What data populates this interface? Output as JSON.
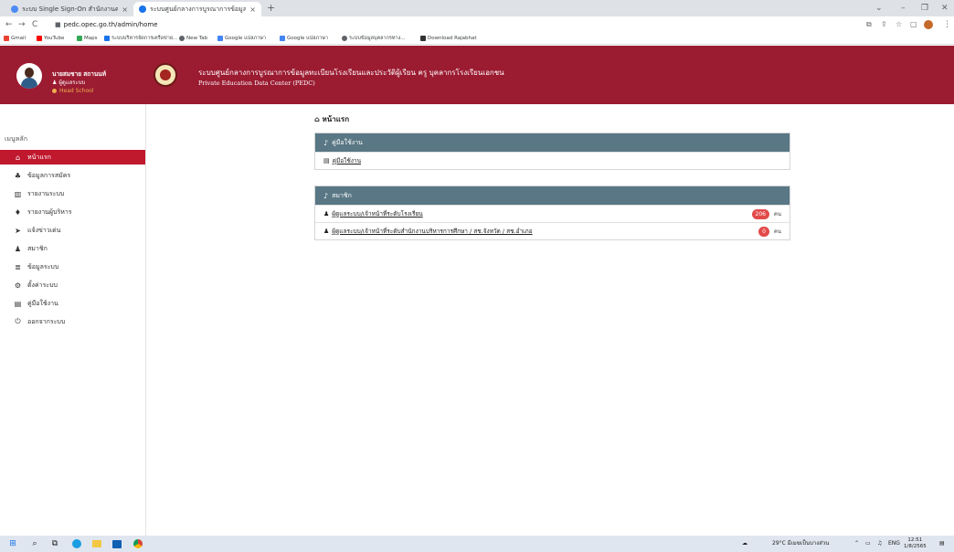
{
  "browser": {
    "tabs": [
      {
        "label": "ระบบ Single Sign-On สำนักงานคณะ...",
        "close": "×",
        "color": "#4c8bf5"
      },
      {
        "label": "ระบบศูนย์กลางการบูรณาการข้อมูล...",
        "close": "×",
        "color": "#1a73e8"
      }
    ],
    "new_tab": "+",
    "window_controls": {
      "chevron": "⌄",
      "minimize": "–",
      "maximize": "❐",
      "close": "✕"
    },
    "nav": {
      "back": "←",
      "forward": "→",
      "reload": "C"
    },
    "url": "pedc.opec.go.th/admin/home",
    "right_icons": {
      "translate": "⧉",
      "share": "⇪",
      "star": "☆",
      "sidepanel": "▢",
      "menu": "⋮"
    },
    "bookmarks": [
      {
        "label": "Gmail",
        "color": "#ea4335"
      },
      {
        "label": "YouTube",
        "color": "#ff0000"
      },
      {
        "label": "Maps",
        "color": "#34a853"
      },
      {
        "label": "ระบบบริหารจัดการเครือข่าย...",
        "color": "#1a73e8"
      },
      {
        "label": "New Tab",
        "color": "#5f6368"
      },
      {
        "label": "Google แปลภาษา",
        "color": "#4285f4"
      },
      {
        "label": "Google แปลภาษา",
        "color": "#4285f4"
      },
      {
        "label": "ระบบข้อมูลบุคลากรทาง...",
        "color": "#5f6368"
      },
      {
        "label": "Download Rajabhat",
        "color": "#333333"
      }
    ]
  },
  "sidebar": {
    "profile": {
      "name": "นายสมชาย สถานนท์",
      "role": "ผู้ดูแลระบบ",
      "status": "Head School"
    },
    "menu_title": "เมนูหลัก",
    "items": [
      {
        "label": "หน้าแรก",
        "icon": "home-icon",
        "glyph": "⌂",
        "active": true
      },
      {
        "label": "ข้อมูลการสมัคร",
        "icon": "users-icon",
        "glyph": "♣",
        "active": false
      },
      {
        "label": "รายงานระบบ",
        "icon": "chart-icon",
        "glyph": "▥",
        "active": false
      },
      {
        "label": "รายงานผู้บริหาร",
        "icon": "manager-icon",
        "glyph": "♦",
        "active": false
      },
      {
        "label": "แจ้งข่าวเด่น",
        "icon": "send-icon",
        "glyph": "➤",
        "active": false
      },
      {
        "label": "สมาชิก",
        "icon": "member-icon",
        "glyph": "♟",
        "active": false
      },
      {
        "label": "ข้อมูลระบบ",
        "icon": "database-icon",
        "glyph": "≣",
        "active": false
      },
      {
        "label": "ตั้งค่าระบบ",
        "icon": "settings-icon",
        "glyph": "⚙",
        "active": false
      },
      {
        "label": "คู่มือใช้งาน",
        "icon": "book-icon",
        "glyph": "▤",
        "active": false
      },
      {
        "label": "ออกจากระบบ",
        "icon": "power-icon",
        "glyph": "⏻",
        "active": false
      }
    ]
  },
  "header": {
    "title": "ระบบศูนย์กลางการบูรณาการข้อมูลทะเบียนโรงเรียนและประวัติผู้เรียน ครู บุคลากรโรงเรียนเอกชน",
    "subtitle": "Private Education Data Center (PEDC)"
  },
  "main": {
    "page_title": "หน้าแรก",
    "manual_card": {
      "header": "คู่มือใช้งาน",
      "rows": [
        {
          "label": "คู่มือใช้งาน"
        }
      ]
    },
    "member_card": {
      "header": "สมาชิก",
      "rows": [
        {
          "label": "ผู้ดูแลระบบ/เจ้าหน้าที่ระดับโรงเรียน",
          "count": "206",
          "unit": "คน"
        },
        {
          "label": "ผู้ดูแลระบบ/เจ้าหน้าที่ระดับสำนักงานบริหารการศึกษา / สช.จังหวัด / สช.อำเภอ",
          "count": "0",
          "unit": "คน"
        }
      ]
    }
  },
  "taskbar": {
    "weather": "29°C มีเมฆเป็นบางส่วน",
    "lang": "ENG",
    "time": "12:51",
    "date": "1/8/2565"
  },
  "colors": {
    "brand": "#9b1b31",
    "active_menu": "#c0182d",
    "card_header": "#597785",
    "badge": "#e34a4a"
  }
}
